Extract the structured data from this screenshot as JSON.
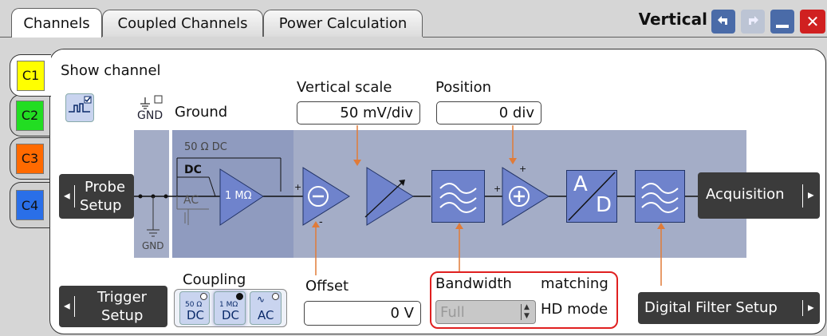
{
  "tabs": {
    "channels": "Channels",
    "coupled": "Coupled Channels",
    "power": "Power Calculation"
  },
  "window": {
    "title": "Vertical",
    "back_icon": "undo-arrow-icon",
    "fwd_icon": "redo-arrow-icon",
    "min_icon": "minimize-icon",
    "close_icon": "close-icon",
    "colors": {
      "back": "#4a6ba8",
      "close": "#d02020",
      "disabled": "#bcc4d4"
    }
  },
  "channels": [
    {
      "label": "C1",
      "color": "#ffff00"
    },
    {
      "label": "C2",
      "color": "#22dd22"
    },
    {
      "label": "C3",
      "color": "#ff6a00"
    },
    {
      "label": "C4",
      "color": "#2a6fe8"
    }
  ],
  "show_channel": {
    "label": "Show channel",
    "checked": true
  },
  "ground": {
    "label": "Ground",
    "icon_text": "GND",
    "checked": false
  },
  "vertical_scale": {
    "label": "Vertical scale",
    "value": "50 mV/div"
  },
  "position": {
    "label": "Position",
    "value": "0 div"
  },
  "offset": {
    "label": "Offset",
    "value": "0 V"
  },
  "diagram": {
    "label_50ohm": "50 Ω DC",
    "label_dc": "DC",
    "label_ac": "AC",
    "label_1m": "1 MΩ",
    "label_gnd": "GND",
    "label_a": "A",
    "label_d": "D",
    "label_plus": "+",
    "label_minus": "-"
  },
  "buttons": {
    "probe_setup_line1": "Probe",
    "probe_setup_line2": "Setup",
    "trigger_setup_line1": "Trigger",
    "trigger_setup_line2": "Setup",
    "acquisition": "Acquisition",
    "digital_filter_setup": "Digital Filter Setup"
  },
  "coupling": {
    "label": "Coupling",
    "options": [
      {
        "top": "50 Ω",
        "bottom": "DC",
        "selected": false
      },
      {
        "top": "1 MΩ",
        "bottom": "DC",
        "selected": true
      },
      {
        "top": "",
        "bottom": "AC",
        "selected": false
      }
    ]
  },
  "bandwidth": {
    "label": "Bandwidth",
    "matching_label": "matching",
    "hd_label": "HD mode",
    "value": "Full",
    "highlight_color": "#e02020"
  },
  "colors": {
    "block": "#6f83cc",
    "diagram_bg": "#a4adc7",
    "orange_line": "#e07b39"
  }
}
